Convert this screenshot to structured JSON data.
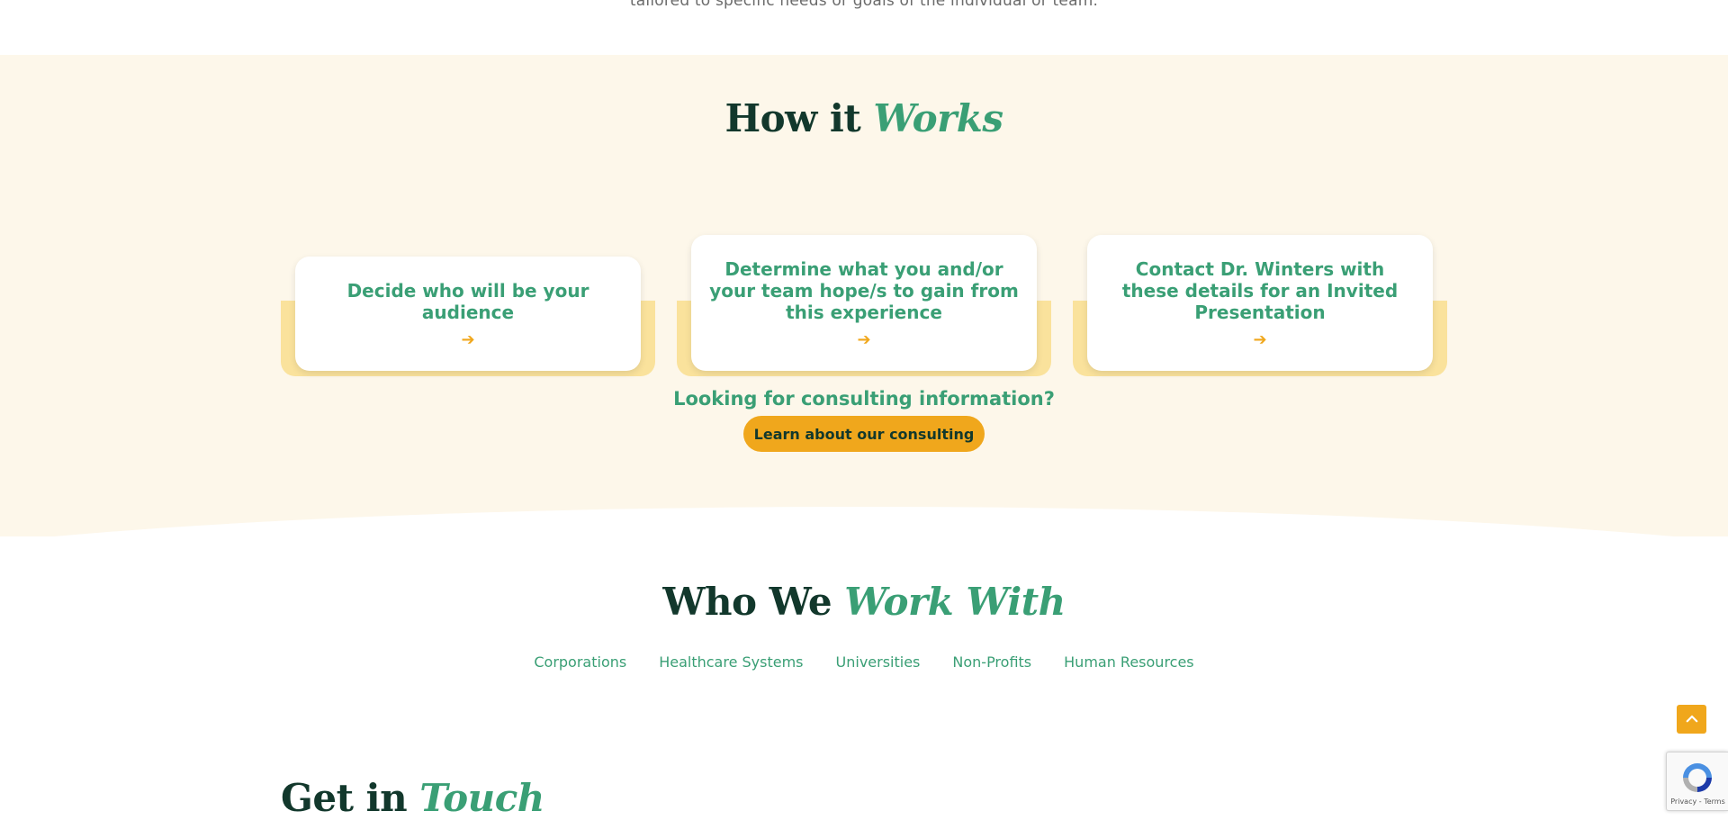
{
  "intro": {
    "text": "tailored to specific needs or goals of the individual or team."
  },
  "how_it_works": {
    "title_plain": "How it ",
    "title_accent": "Works",
    "cards": [
      {
        "title": "Decide who will be your audience",
        "arrow_icon": "arrow-right-icon"
      },
      {
        "title": "Determine what you and/or your team hope/s to gain from this experience",
        "arrow_icon": "arrow-right-icon"
      },
      {
        "title": "Contact Dr. Winters with these details for an Invited Presentation",
        "arrow_icon": "arrow-right-icon"
      }
    ],
    "consulting_question": "Looking for consulting information?",
    "consulting_button": "Learn about our consulting"
  },
  "who_we_work_with": {
    "title_plain": "Who We ",
    "title_accent": "Work With",
    "items": [
      "Corporations",
      "Healthcare Systems",
      "Universities",
      "Non-Profits",
      "Human Resources"
    ]
  },
  "get_in_touch": {
    "title_plain": "Get in ",
    "title_accent": "Touch"
  },
  "widgets": {
    "scroll_top_icon": "chevron-up-icon",
    "recaptcha_terms": "Privacy - Terms"
  },
  "colors": {
    "accent_green": "#3a9f75",
    "dark_green": "#12382c",
    "gold": "#f0a71c",
    "cream": "#fdf7ea",
    "card_shadow": "#fae29c"
  }
}
